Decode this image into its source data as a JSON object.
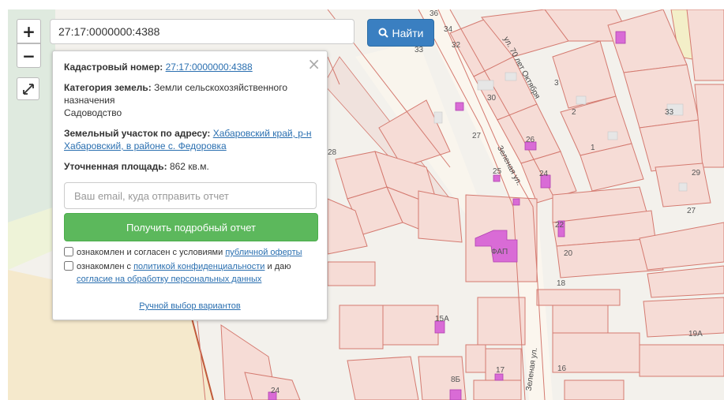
{
  "search": {
    "value": "27:17:0000000:4388",
    "button_label": "Найти"
  },
  "zoom": {
    "in_label": "+",
    "out_label": "−"
  },
  "panel": {
    "cadastral_label": "Кадастровый номер:",
    "cadastral_value": "27:17:0000000:4388",
    "category_label": "Категория земель:",
    "category_value": "Земли сельскохозяйственного назначения",
    "use_value": "Садоводство",
    "address_label": "Земельный участок по адресу:",
    "address_value": "Хабаровский край, р-н Хабаровский, в районе с. Федоровка",
    "area_label": "Уточненная площадь:",
    "area_value": "862 кв.м.",
    "email_placeholder": "Ваш email, куда отправить отчет",
    "report_button": "Получить подробный отчет",
    "offer_text": "ознакомлен и согласен с условиями",
    "offer_link": "публичной оферты",
    "privacy_text_1": "ознакомлен с",
    "privacy_link": "политикой конфиденциальности",
    "privacy_text_2": "и даю",
    "consent_link": "согласие на обработку персональных данных",
    "manual_link": "Ручной выбор вариантов"
  },
  "map": {
    "labels": [
      "36",
      "34",
      "32",
      "33",
      "30",
      "27",
      "26",
      "25",
      "24",
      "28",
      "3",
      "2",
      "1",
      "33",
      "29",
      "27",
      "22",
      "20",
      "18",
      "16",
      "15А",
      "17",
      "8Б",
      "24",
      "19А",
      "ФАП"
    ],
    "streets": [
      "ул. 70 лет Октября",
      "Зеленая ул.",
      "Зеленая ул."
    ]
  },
  "colors": {
    "parcel_fill": "#f6dcd6",
    "parcel_stroke": "#d47a70",
    "building": "#d96bd6",
    "search_button": "#3a7fc1",
    "report_button": "#5cb85c"
  }
}
